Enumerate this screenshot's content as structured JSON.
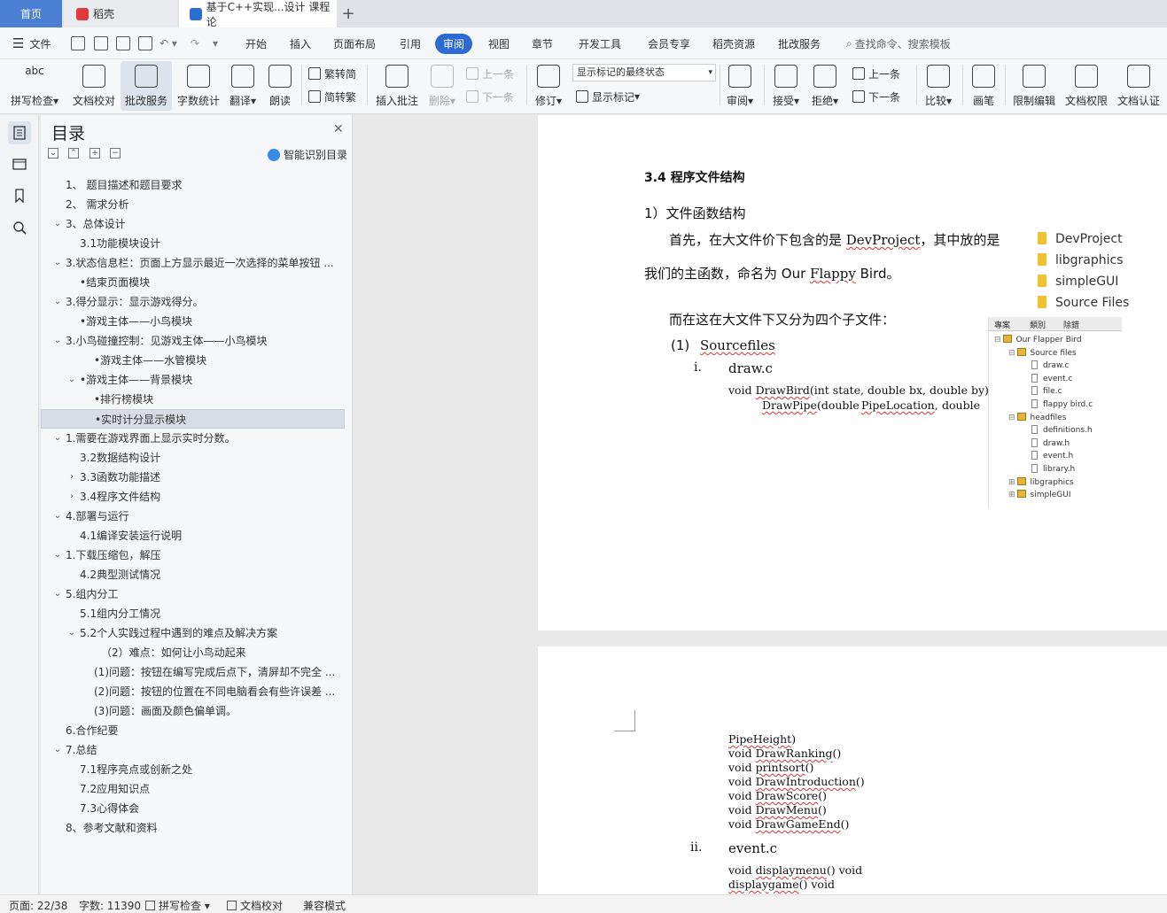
{
  "tabs": {
    "home": "首页",
    "daoke": "稻壳",
    "doc": "基于C++实现...设计 课程论",
    "plus": "+"
  },
  "menu": {
    "file": "文件",
    "items": [
      "开始",
      "插入",
      "页面布局",
      "引用",
      "审阅",
      "视图",
      "章节",
      "开发工具",
      "会员专享",
      "稻壳资源",
      "批改服务"
    ],
    "active": "审阅",
    "search": "查找命令、搜索模板"
  },
  "ribbon": {
    "spell": "拼写检查",
    "proof": "文档校对",
    "review_service": "批改服务",
    "wordcount": "字数统计",
    "translate": "翻译",
    "read": "朗读",
    "t2s": "繁转简",
    "s2t": "简转繁",
    "insert_comment": "插入批注",
    "delete": "删除",
    "prev": "上一条",
    "next": "下一条",
    "revise": "修订",
    "mark_state": "显示标记的最终状态",
    "show_marks": "显示标记",
    "review": "审阅",
    "accept": "接受",
    "reject": "拒绝",
    "prev2": "上一条",
    "next2": "下一条",
    "compare": "比较",
    "pen": "画笔",
    "restrict": "限制编辑",
    "permission": "文档权限",
    "certify": "文档认证"
  },
  "toc": {
    "title": "目录",
    "ai": "智能识别目录",
    "items": [
      {
        "text": "1、 题目描述和题目要求",
        "level": 0,
        "chev": ""
      },
      {
        "text": "2、 需求分析",
        "level": 0,
        "chev": ""
      },
      {
        "text": "3、总体设计",
        "level": 0,
        "chev": "v"
      },
      {
        "text": "3.1功能模块设计",
        "level": 1,
        "chev": ""
      },
      {
        "text": "3.状态信息栏：页面上方显示最近一次选择的菜单按钮 ...",
        "level": 0,
        "chev": "v"
      },
      {
        "text": "•结束页面模块",
        "level": 1,
        "chev": ""
      },
      {
        "text": "3.得分显示：显示游戏得分。",
        "level": 0,
        "chev": "v"
      },
      {
        "text": "•游戏主体——小鸟模块",
        "level": 1,
        "chev": ""
      },
      {
        "text": "3.小鸟碰撞控制：见游戏主体——小鸟模块",
        "level": 0,
        "chev": "v"
      },
      {
        "text": "•游戏主体——水管模块",
        "level": 2,
        "chev": ""
      },
      {
        "text": "•游戏主体——背景模块",
        "level": 1,
        "chev": "v"
      },
      {
        "text": "•排行榜模块",
        "level": 2,
        "chev": ""
      },
      {
        "text": "•实时计分显示模块",
        "level": 2,
        "chev": "",
        "selected": true
      },
      {
        "text": "1.需要在游戏界面上显示实时分数。",
        "level": 0,
        "chev": "v"
      },
      {
        "text": "3.2数据结构设计",
        "level": 1,
        "chev": ""
      },
      {
        "text": "3.3函数功能描述",
        "level": 1,
        "chev": ">"
      },
      {
        "text": "3.4程序文件结构",
        "level": 1,
        "chev": ">"
      },
      {
        "text": "4.部署与运行",
        "level": 0,
        "chev": "v"
      },
      {
        "text": "4.1编译安装运行说明",
        "level": 1,
        "chev": ""
      },
      {
        "text": "1.下载压缩包，解压",
        "level": 0,
        "chev": "v"
      },
      {
        "text": "4.2典型测试情况",
        "level": 1,
        "chev": ""
      },
      {
        "text": "5.组内分工",
        "level": 0,
        "chev": "v"
      },
      {
        "text": "5.1组内分工情况",
        "level": 1,
        "chev": ""
      },
      {
        "text": "5.2个人实践过程中遇到的难点及解决方案",
        "level": 1,
        "chev": "v"
      },
      {
        "text": "（2）难点：如何让小鸟动起来",
        "level": 3,
        "chev": ""
      },
      {
        "text": "(1)问题：按钮在编写完成后点下，清屏却不完全 ...",
        "level": 2,
        "chev": ""
      },
      {
        "text": "(2)问题：按钮的位置在不同电脑看会有些许误差 ...",
        "level": 2,
        "chev": ""
      },
      {
        "text": "(3)问题：画面及颜色偏单调。",
        "level": 2,
        "chev": ""
      },
      {
        "text": "6.合作纪要",
        "level": 0,
        "chev": ""
      },
      {
        "text": "7.总结",
        "level": 0,
        "chev": "v"
      },
      {
        "text": "7.1程序亮点或创新之处",
        "level": 1,
        "chev": ""
      },
      {
        "text": "7.2应用知识点",
        "level": 1,
        "chev": ""
      },
      {
        "text": "7.3心得体会",
        "level": 1,
        "chev": ""
      },
      {
        "text": "8、参考文献和资料",
        "level": 0,
        "chev": ""
      }
    ]
  },
  "page1": {
    "heading": "3.4  程序文件结构",
    "sub": "1）文件函数结构",
    "para1a": "首先，在大文件价下包含的是 ",
    "para1b": "DevProject",
    "para1c": "，其中放的是",
    "para2a": "我们的主函数，命名为 Our ",
    "para2b": "Flappy",
    "para2c": " Bird。",
    "para3": "而在这在大文件下又分为四个子文件：",
    "list1": "(1)",
    "list1_text": "Sourcefiles",
    "item_i": "i.",
    "item_i_text": "draw.c",
    "code1a": "void ",
    "code1b": "DrawBird",
    "code1c": "(int state, double bx, double by) void",
    "code2a": "DrawPipe",
    "code2b": "(double",
    "code2c": "PipeLocation",
    "code2d": ",",
    "code2e": "double",
    "folders": [
      "DevProject",
      "libgraphics",
      "simpleGUI",
      "Source Files"
    ],
    "tree_tabs": [
      "專案",
      "類別",
      "除錯"
    ],
    "tree": [
      {
        "t": "Our Flapper Bird",
        "k": "fo",
        "indent": 0,
        "exp": "⊟"
      },
      {
        "t": "Source files",
        "k": "fo",
        "indent": 1,
        "exp": "⊟"
      },
      {
        "t": "draw.c",
        "k": "fi",
        "indent": 2,
        "exp": ""
      },
      {
        "t": "event.c",
        "k": "fi",
        "indent": 2,
        "exp": ""
      },
      {
        "t": "file.c",
        "k": "fi",
        "indent": 2,
        "exp": ""
      },
      {
        "t": "flappy bird.c",
        "k": "fi",
        "indent": 2,
        "exp": ""
      },
      {
        "t": "headfiles",
        "k": "fo",
        "indent": 1,
        "exp": "⊟"
      },
      {
        "t": "definitions.h",
        "k": "fi",
        "indent": 2,
        "exp": ""
      },
      {
        "t": "draw.h",
        "k": "fi",
        "indent": 2,
        "exp": ""
      },
      {
        "t": "event.h",
        "k": "fi",
        "indent": 2,
        "exp": ""
      },
      {
        "t": "library.h",
        "k": "fi",
        "indent": 2,
        "exp": ""
      },
      {
        "t": "libgraphics",
        "k": "fo",
        "indent": 1,
        "exp": "⊞"
      },
      {
        "t": "simpleGUI",
        "k": "fo",
        "indent": 1,
        "exp": "⊞"
      }
    ]
  },
  "page2": {
    "lines": [
      {
        "pre": "",
        "w": "PipeHeight",
        "post": ")"
      },
      {
        "pre": "void ",
        "w": "DrawRanking",
        "post": "()"
      },
      {
        "pre": "void ",
        "w": "printsort",
        "post": "()"
      },
      {
        "pre": "void ",
        "w": "DrawIntroduction",
        "post": "()"
      },
      {
        "pre": "void ",
        "w": "DrawScore",
        "post": "()"
      },
      {
        "pre": "void ",
        "w": "DrawMenu",
        "post": "()"
      },
      {
        "pre": "void ",
        "w": "DrawGameEnd",
        "post": "()"
      }
    ],
    "item_ii": "ii.",
    "item_ii_text": "event.c",
    "ev1a": "void ",
    "ev1b": "displaymenu",
    "ev1c": "() void",
    "ev2a": "displaygame",
    "ev2b": "() void"
  },
  "status": {
    "page": "页面: 22/38",
    "words": "字数: 11390",
    "spell": "拼写检查",
    "proof": "文档校对",
    "compat": "兼容模式"
  }
}
